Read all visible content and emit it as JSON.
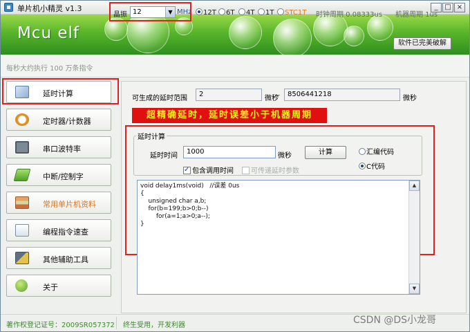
{
  "window": {
    "title": "单片机小精灵  v1.3",
    "controls": [
      "_",
      "□",
      "×"
    ]
  },
  "banner": {
    "logo": "Mcu elf",
    "crack_label": "软件已完美破解"
  },
  "infobar": {
    "speed_text": "每秒大约执行 100 万条指令",
    "crystal_label": "晶振",
    "crystal_value": "12",
    "crystal_unit": "MHz",
    "cycle_options": [
      {
        "label": "12T",
        "selected": true
      },
      {
        "label": "6T",
        "selected": false
      },
      {
        "label": "4T",
        "selected": false
      },
      {
        "label": "1T",
        "selected": false
      },
      {
        "label": "STC1T",
        "selected": false
      }
    ],
    "clock_period": "时钟周期 0.08333us",
    "machine_period": "机器周期 1us"
  },
  "sidebar": {
    "items": [
      {
        "label": "延时计算",
        "icon": "calculator-icon",
        "active": true
      },
      {
        "label": "定时器/计数器",
        "icon": "alarm-clock-icon",
        "active": false
      },
      {
        "label": "串口波特率",
        "icon": "monitor-icon",
        "active": false
      },
      {
        "label": "中断/控制字",
        "icon": "chip-icon",
        "active": false
      },
      {
        "label": "常用单片机资料",
        "icon": "books-icon",
        "active": false
      },
      {
        "label": "编程指令速查",
        "icon": "document-icon",
        "active": false
      },
      {
        "label": "其他辅助工具",
        "icon": "tools-icon",
        "active": false
      },
      {
        "label": "关于",
        "icon": "info-icon",
        "active": false
      }
    ]
  },
  "main": {
    "range_label": "可生成的延时范围",
    "range_min": "2",
    "range_min_unit": "微秒",
    "range_sep": "~",
    "range_max": "8506441218",
    "range_max_unit": "微秒",
    "promo": "超精确延时，延时误差小于机器周期",
    "group_title": "延时计算",
    "delay_label": "延时时间",
    "delay_value": "1000",
    "delay_unit": "微秒",
    "calc_button": "计算",
    "include_call": "包含调用时间",
    "pass_param": "可传递延时参数",
    "output_asm": "汇编代码",
    "output_c": "C代码",
    "code": "void delay1ms(void)   //误差 0us\n{\n    unsigned char a,b;\n    for(b=199;b>0;b--)\n        for(a=1;a>0;a--);\n}"
  },
  "status": {
    "copyright": "著作权登记证号：2009SR057372",
    "slogan": "终生受用，开发利器"
  },
  "watermark": "CSDN @DS小龙哥",
  "colors": {
    "highlight": "#e02020",
    "promo_bg": "#e01010",
    "promo_text": "#ffee22",
    "status_green": "#3c8a2a",
    "stc_orange": "#e07a20"
  }
}
